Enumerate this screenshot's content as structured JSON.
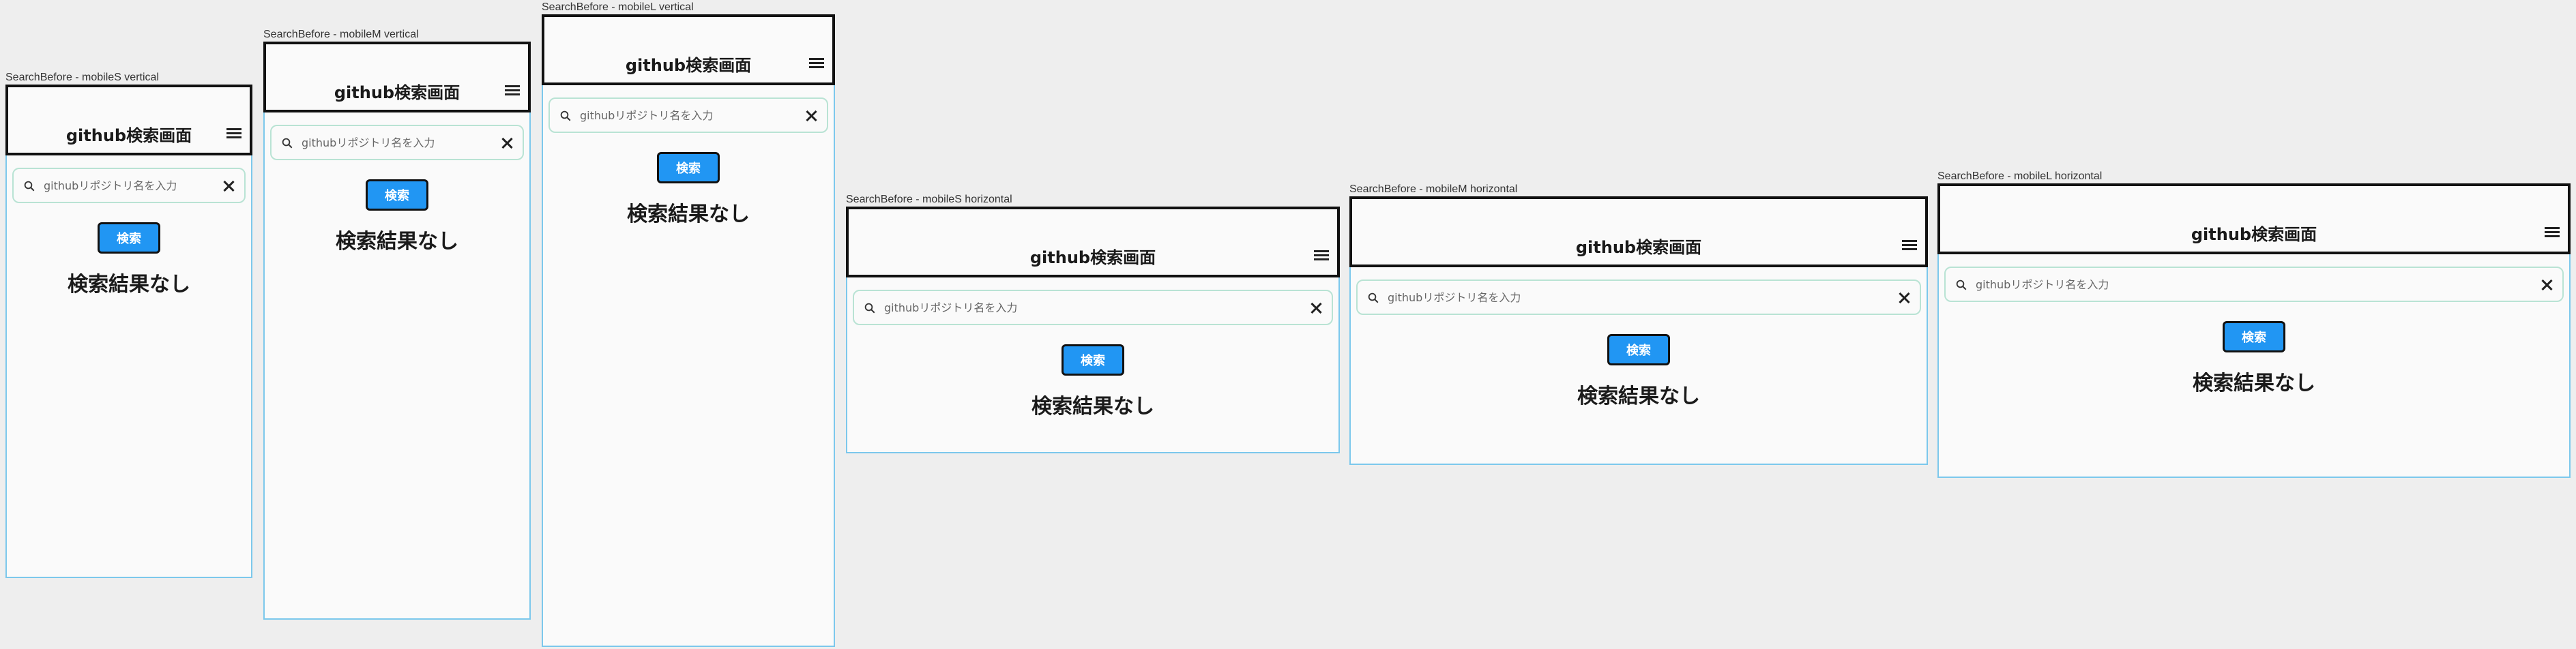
{
  "frames": [
    {
      "label": "SearchBefore - mobileS vertical",
      "title": "github検索画面",
      "search_placeholder": "githubリポジトリ名を入力",
      "search_button": "検索",
      "empty_message": "検索結果なし"
    },
    {
      "label": "SearchBefore - mobileM vertical",
      "title": "github検索画面",
      "search_placeholder": "githubリポジトリ名を入力",
      "search_button": "検索",
      "empty_message": "検索結果なし"
    },
    {
      "label": "SearchBefore - mobileL vertical",
      "title": "github検索画面",
      "search_placeholder": "githubリポジトリ名を入力",
      "search_button": "検索",
      "empty_message": "検索結果なし"
    },
    {
      "label": "SearchBefore - mobileS horizontal",
      "title": "github検索画面",
      "search_placeholder": "githubリポジトリ名を入力",
      "search_button": "検索",
      "empty_message": "検索結果なし"
    },
    {
      "label": "SearchBefore - mobileM horizontal",
      "title": "github検索画面",
      "search_placeholder": "githubリポジトリ名を入力",
      "search_button": "検索",
      "empty_message": "検索結果なし"
    },
    {
      "label": "SearchBefore - mobileL horizontal",
      "title": "github検索画面",
      "search_placeholder": "githubリポジトリ名を入力",
      "search_button": "検索",
      "empty_message": "検索結果なし"
    }
  ],
  "icons": {
    "search": "search-icon",
    "clear": "close-icon",
    "menu": "hamburger-menu-icon"
  },
  "colors": {
    "button": "#2196f3",
    "frame_border": "#7cc8ec",
    "search_border": "#b9e3d4",
    "background": "#eeeeee",
    "frame_background": "#fafafa"
  }
}
